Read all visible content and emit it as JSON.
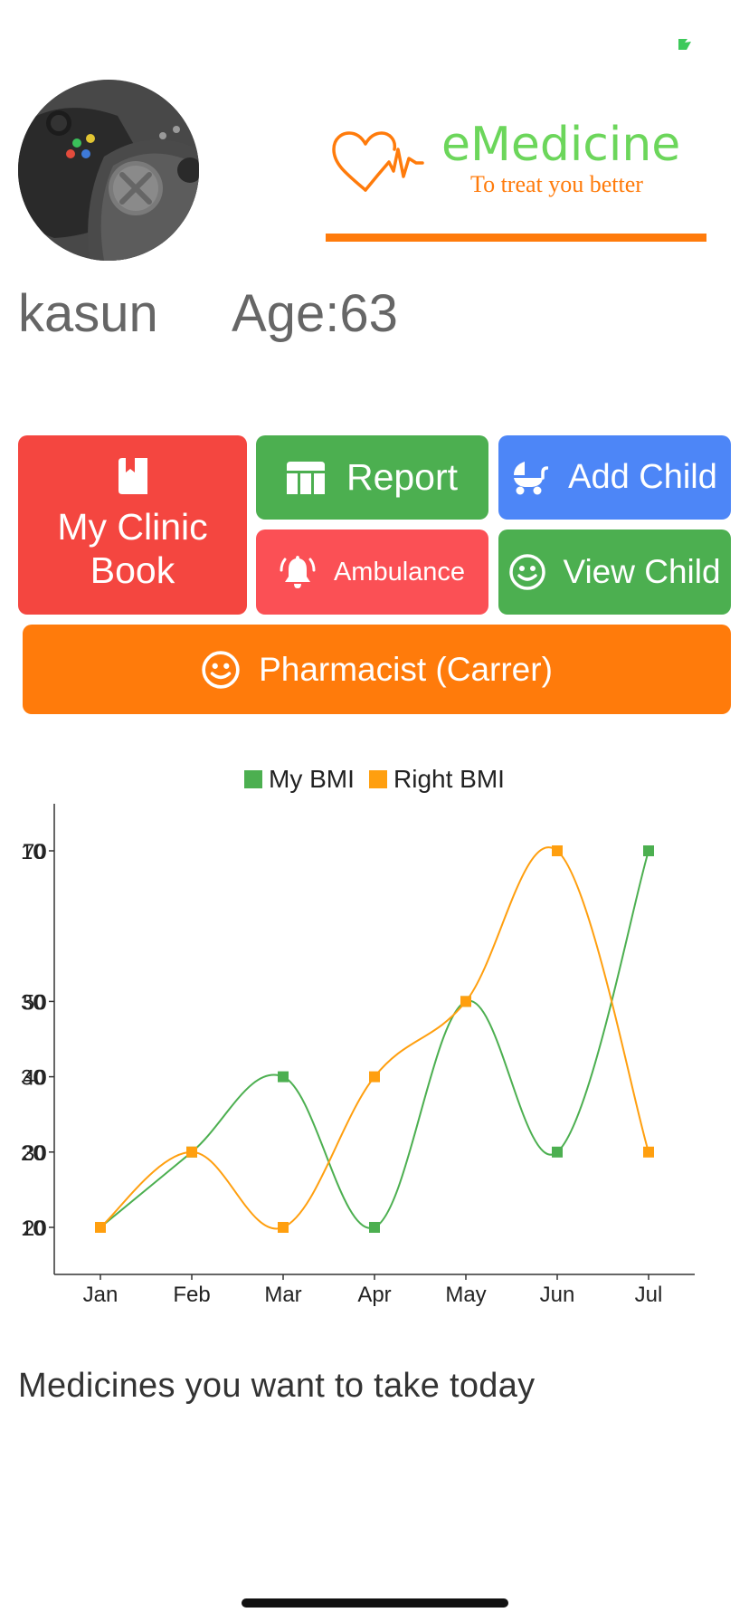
{
  "profile": {
    "name": "kasun",
    "age_label": "Age:63"
  },
  "logo": {
    "brand": "eMedicine",
    "tagline": "To treat you better"
  },
  "actions": {
    "clinic_book": "My Clinic Book",
    "report": "Report",
    "add_child": "Add Child",
    "ambulance": "Ambulance",
    "view_child": "View Child",
    "pharmacist": "Pharmacist (Carrer)"
  },
  "colors": {
    "clinic": "#f44640",
    "report": "#4caf50",
    "add_child": "#4d86f7",
    "ambulance": "#fb5055",
    "view_child": "#4caf50",
    "pharmacist": "#ff7b0b",
    "my_bmi": "#4caf50",
    "right_bmi": "#ff9f0f"
  },
  "icons": {
    "clinic": "book-icon",
    "report": "table-icon",
    "add_child": "baby-carriage-icon",
    "ambulance": "bell-icon",
    "view_child": "smile-icon",
    "pharmacist": "smile-icon"
  },
  "chart_data": {
    "type": "line",
    "categories": [
      "Jan",
      "Feb",
      "Mar",
      "Apr",
      "May",
      "Jun",
      "Jul"
    ],
    "series": [
      {
        "name": "My BMI",
        "values": [
          20,
          30,
          40,
          20,
          50,
          30,
          70
        ],
        "color": "#4caf50"
      },
      {
        "name": "Right BMI",
        "values": [
          20,
          30,
          20,
          40,
          50,
          70,
          30
        ],
        "color": "#ff9f0f"
      }
    ],
    "y_ticks": [
      "10",
      "20",
      "30",
      "40",
      "50",
      "70"
    ],
    "ylim": [
      20,
      70
    ],
    "legend_position": "top-center",
    "grid": false,
    "smooth": true
  },
  "section": {
    "medicines_title": "Medicines you want to take today"
  }
}
